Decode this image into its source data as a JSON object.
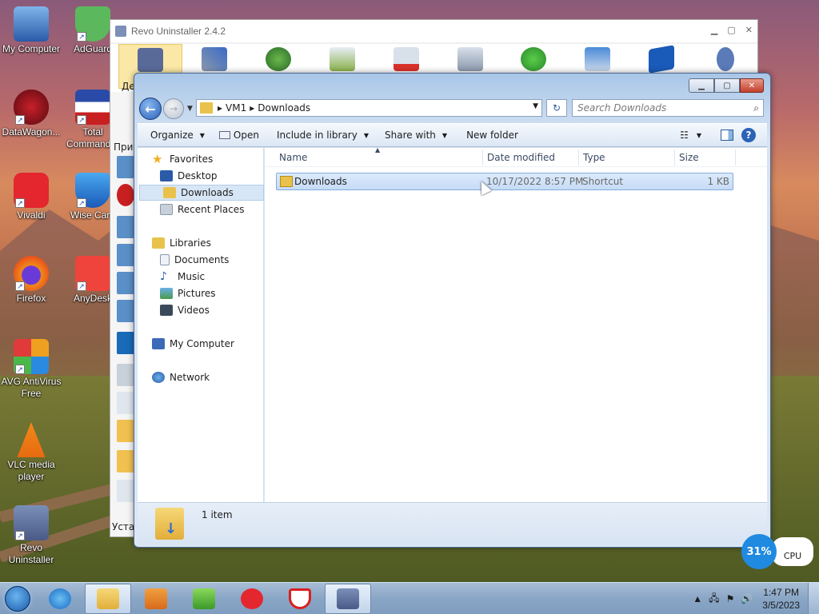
{
  "desktop": {
    "icons": [
      {
        "label": "My Computer"
      },
      {
        "label": "AdGuard"
      },
      {
        "label": "DataWagon..."
      },
      {
        "label": "Total Commander"
      },
      {
        "label": "Vivaldi"
      },
      {
        "label": "Wise Care"
      },
      {
        "label": "Firefox"
      },
      {
        "label": "AnyDesk"
      },
      {
        "label": "AVG AntiVirus Free"
      },
      {
        "label": "VLC media player"
      },
      {
        "label": "Revo Uninstaller"
      }
    ]
  },
  "revo": {
    "title": "Revo Uninstaller 2.4.2",
    "left_labels": [
      "Де",
      "При",
      "Уста"
    ]
  },
  "explorer": {
    "address": {
      "crumbs": [
        "VM1",
        "Downloads"
      ]
    },
    "search_placeholder": "Search Downloads",
    "toolbar": {
      "organize": "Organize",
      "open": "Open",
      "include_in_library": "Include in library",
      "share_with": "Share with",
      "new_folder": "New folder"
    },
    "nav": {
      "favorites": "Favorites",
      "desktop": "Desktop",
      "downloads": "Downloads",
      "recent_places": "Recent Places",
      "libraries": "Libraries",
      "documents": "Documents",
      "music": "Music",
      "pictures": "Pictures",
      "videos": "Videos",
      "my_computer": "My Computer",
      "network": "Network"
    },
    "columns": {
      "name": "Name",
      "date_modified": "Date modified",
      "type": "Type",
      "size": "Size"
    },
    "files": [
      {
        "name": "Downloads",
        "date_modified": "10/17/2022 8:57 PM",
        "type": "Shortcut",
        "size": "1 KB"
      }
    ],
    "status": {
      "count": "1 item"
    }
  },
  "widget": {
    "cpu_percent": "31%",
    "cpu_label": "CPU"
  },
  "taskbar": {
    "clock_time": "1:47 PM",
    "clock_date": "3/5/2023"
  },
  "colors": {
    "accent": "#2a60b8",
    "selection": "#c6dbf6"
  }
}
